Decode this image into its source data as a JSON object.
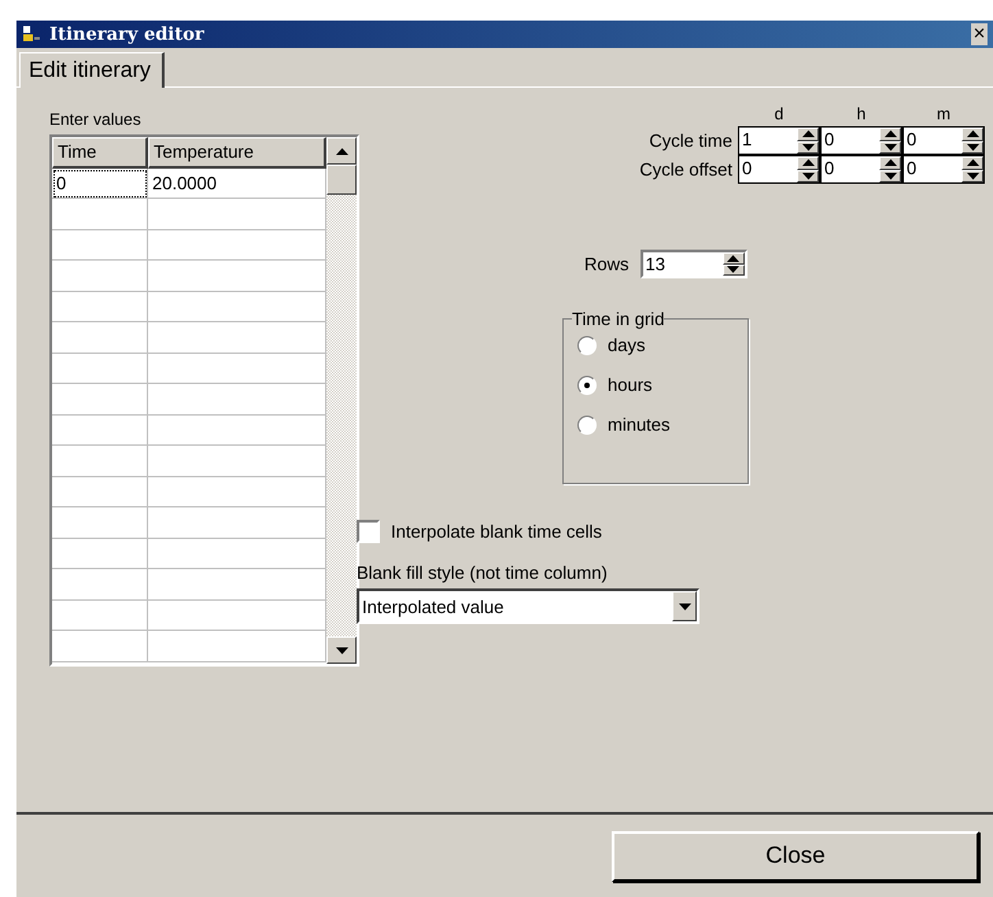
{
  "window": {
    "title": "Itinerary editor",
    "close": "×"
  },
  "tabs": [
    {
      "label": "Edit itinerary",
      "selected": true
    }
  ],
  "grid": {
    "caption": "Enter values",
    "columns": [
      "Time",
      "Temperature"
    ],
    "rows": [
      {
        "cells": [
          "0",
          "20.0000"
        ],
        "focused": true
      }
    ]
  },
  "cycle": {
    "units": [
      "d",
      "h",
      "m"
    ],
    "rows": [
      {
        "label": "Cycle time",
        "values": [
          "1",
          "0",
          "0"
        ]
      },
      {
        "label": "Cycle offset",
        "values": [
          "0",
          "0",
          "0"
        ]
      }
    ]
  },
  "rows_field": {
    "label": "Rows",
    "value": "13"
  },
  "time_in_grid": {
    "title": "Time in grid",
    "options": [
      {
        "label": "days",
        "selected": false
      },
      {
        "label": "hours",
        "selected": true
      },
      {
        "label": "minutes",
        "selected": false
      }
    ]
  },
  "interpolate": {
    "label": "Interpolate blank time cells",
    "checked": false
  },
  "blank_fill": {
    "label": "Blank fill style (not time column)",
    "value": "Interpolated value"
  },
  "buttons": [
    "Close"
  ]
}
